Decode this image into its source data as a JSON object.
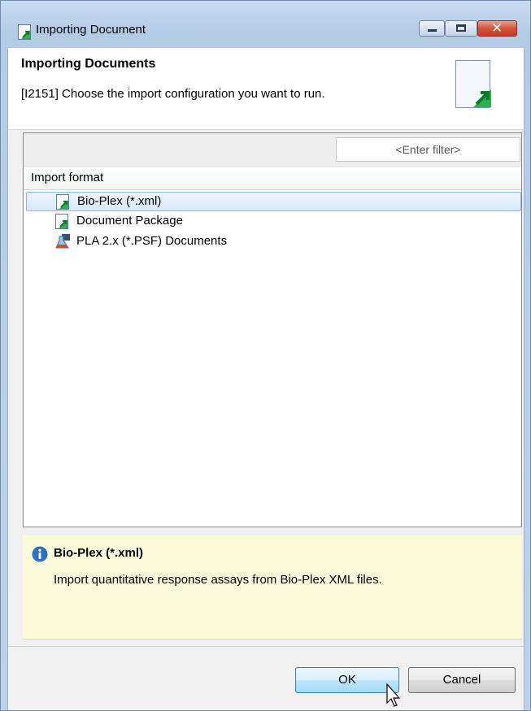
{
  "window": {
    "title": "Importing Document"
  },
  "header": {
    "title": "Importing Documents",
    "message": "[I2151] Choose the import configuration you want to run."
  },
  "filter": {
    "placeholder": "<Enter filter>",
    "value": ""
  },
  "table": {
    "column_header": "Import format",
    "items": [
      {
        "label": "Bio-Plex (*.xml)",
        "icon": "import-document-icon",
        "selected": true
      },
      {
        "label": "Document Package",
        "icon": "import-document-icon",
        "selected": false
      },
      {
        "label": "PLA 2.x (*.PSF) Documents",
        "icon": "pla-flask-icon",
        "selected": false
      }
    ]
  },
  "info": {
    "icon": "info-icon",
    "title": "Bio-Plex (*.xml)",
    "description": "Import quantitative response assays from Bio-Plex XML files."
  },
  "buttons": {
    "ok": "OK",
    "cancel": "Cancel"
  },
  "colors": {
    "selection": "#d7e8fb",
    "info_background": "#fbfbdc",
    "accent_green": "#2db24a"
  }
}
